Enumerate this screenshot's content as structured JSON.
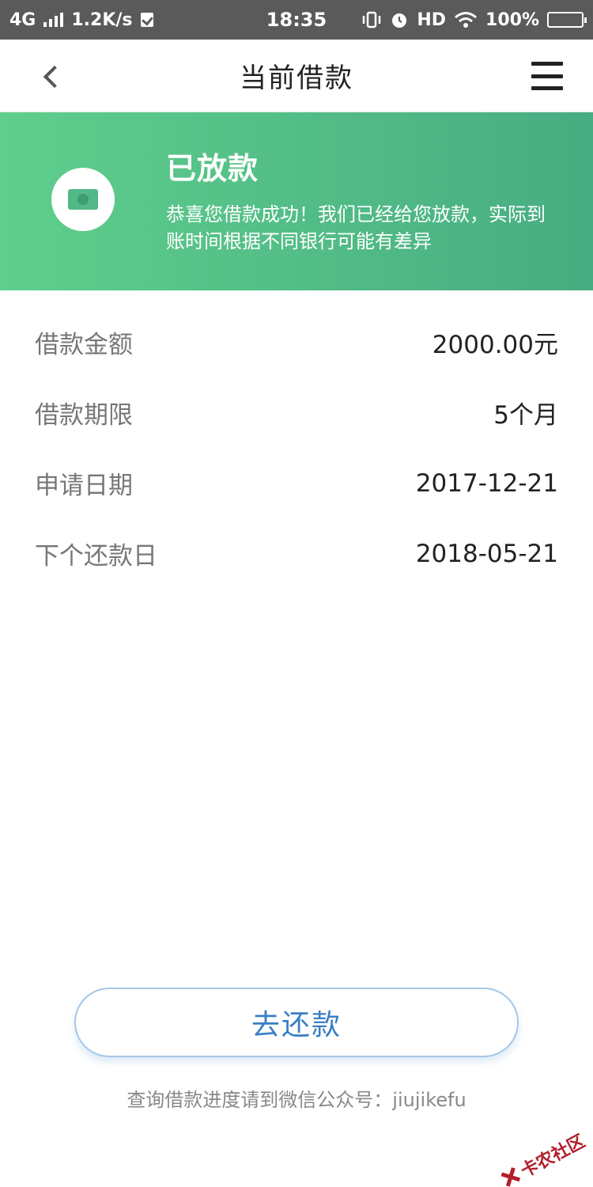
{
  "status_bar": {
    "network": "4G",
    "speed": "1.2K/s",
    "time": "18:35",
    "hd": "HD",
    "battery": "100%",
    "battery_level": 1.0
  },
  "nav": {
    "title": "当前借款",
    "back_icon": "chevron-left-icon",
    "menu_icon": "hamburger-menu-icon"
  },
  "banner": {
    "title": "已放款",
    "description": "恭喜您借款成功！我们已经给您放款，实际到账时间根据不同银行可能有差异",
    "icon": "cash-icon",
    "gradient_start": "#5fce8c",
    "gradient_end": "#47ad82"
  },
  "details": [
    {
      "label": "借款金额",
      "value": "2000.00元"
    },
    {
      "label": "借款期限",
      "value": "5个月"
    },
    {
      "label": "申请日期",
      "value": "2017-12-21"
    },
    {
      "label": "下个还款日",
      "value": "2018-05-21"
    }
  ],
  "repay_button": {
    "label": "去还款",
    "color": "#3a7fc4"
  },
  "footer_note": "查询借款进度请到微信公众号：jiujikefu",
  "watermark": {
    "text": "卡农社区"
  }
}
